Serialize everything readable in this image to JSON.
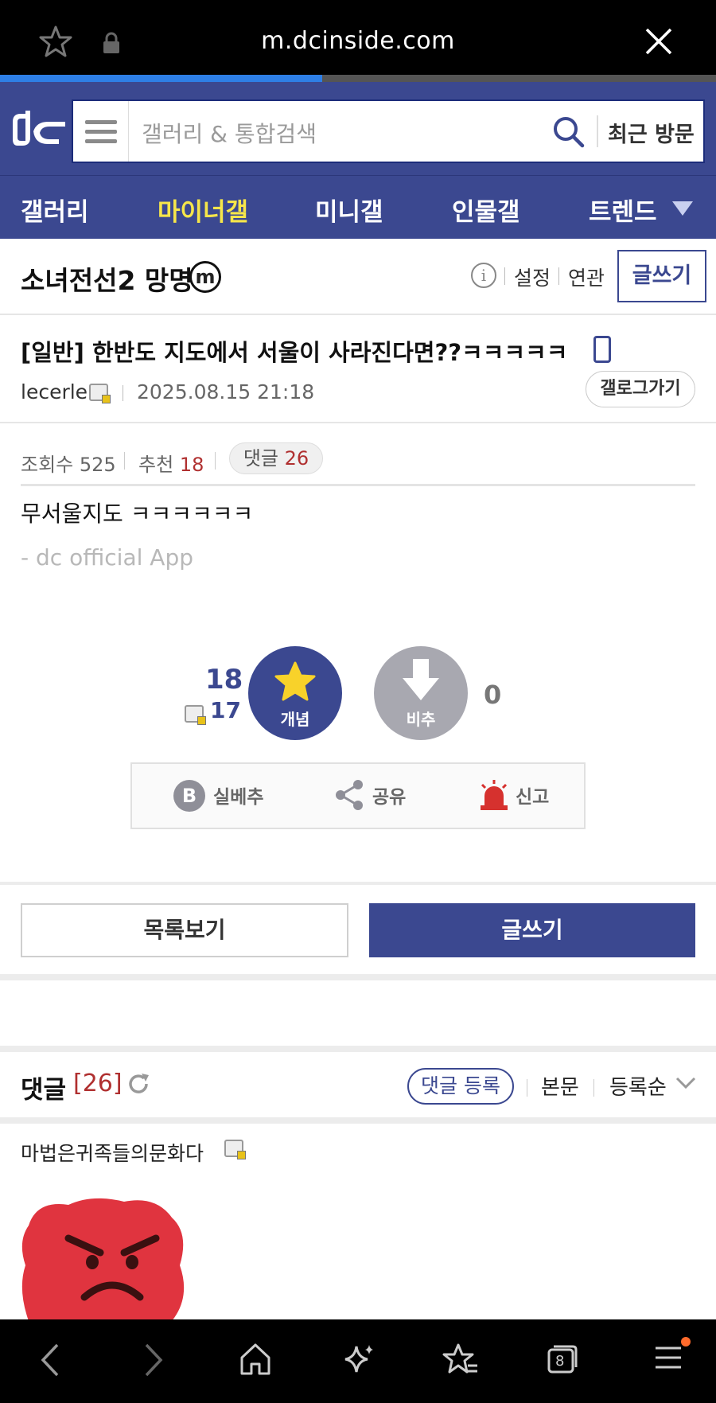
{
  "browser": {
    "url": "m.dcinside.com",
    "load_progress": 0.45,
    "tab_count": "8"
  },
  "header": {
    "search_placeholder": "갤러리 & 통합검색",
    "recent_label": "최근 방문"
  },
  "nav": {
    "tabs": [
      {
        "label": "갤러리",
        "active": false
      },
      {
        "label": "마이너갤",
        "active": true
      },
      {
        "label": "미니갤",
        "active": false
      },
      {
        "label": "인물갤",
        "active": false
      },
      {
        "label": "트렌드",
        "active": false
      }
    ]
  },
  "gallery": {
    "name": "소녀전선2 망명",
    "badge": "m",
    "setting_label": "설정",
    "related_label": "연관",
    "write_label": "글쓰기"
  },
  "post": {
    "title": "[일반] 한반도 지도에서 서울이 사라진다면??ㅋㅋㅋㅋㅋ",
    "author": "lecerle",
    "date": "2025.08.15 21:18",
    "gallog_button": "갤로그가기",
    "views_label": "조회수 525",
    "recommend_label": "추천",
    "recommend_count": "18",
    "comment_label": "댓글",
    "comment_count": "26",
    "body": "무서울지도 ㅋㅋㅋㅋㅋㅋ",
    "signature": "- dc official App"
  },
  "recommend": {
    "up_count": "18",
    "fixed_count": "17",
    "up_label": "개념",
    "down_label": "비추",
    "down_count": "0"
  },
  "actions": {
    "best_label": "실베추",
    "share_label": "공유",
    "report_label": "신고"
  },
  "buttons": {
    "list_label": "목록보기",
    "write_label": "글쓰기"
  },
  "comments": {
    "title": "댓글",
    "count": "[26]",
    "register_label": "댓글 등록",
    "body_label": "본문",
    "sort_label": "등록순",
    "first_author": "마법은귀족들의문화다"
  },
  "colors": {
    "brand": "#3b4890",
    "active_tab": "#f6e64a",
    "count_red": "#b03030",
    "progress": "#2e7fe6"
  }
}
